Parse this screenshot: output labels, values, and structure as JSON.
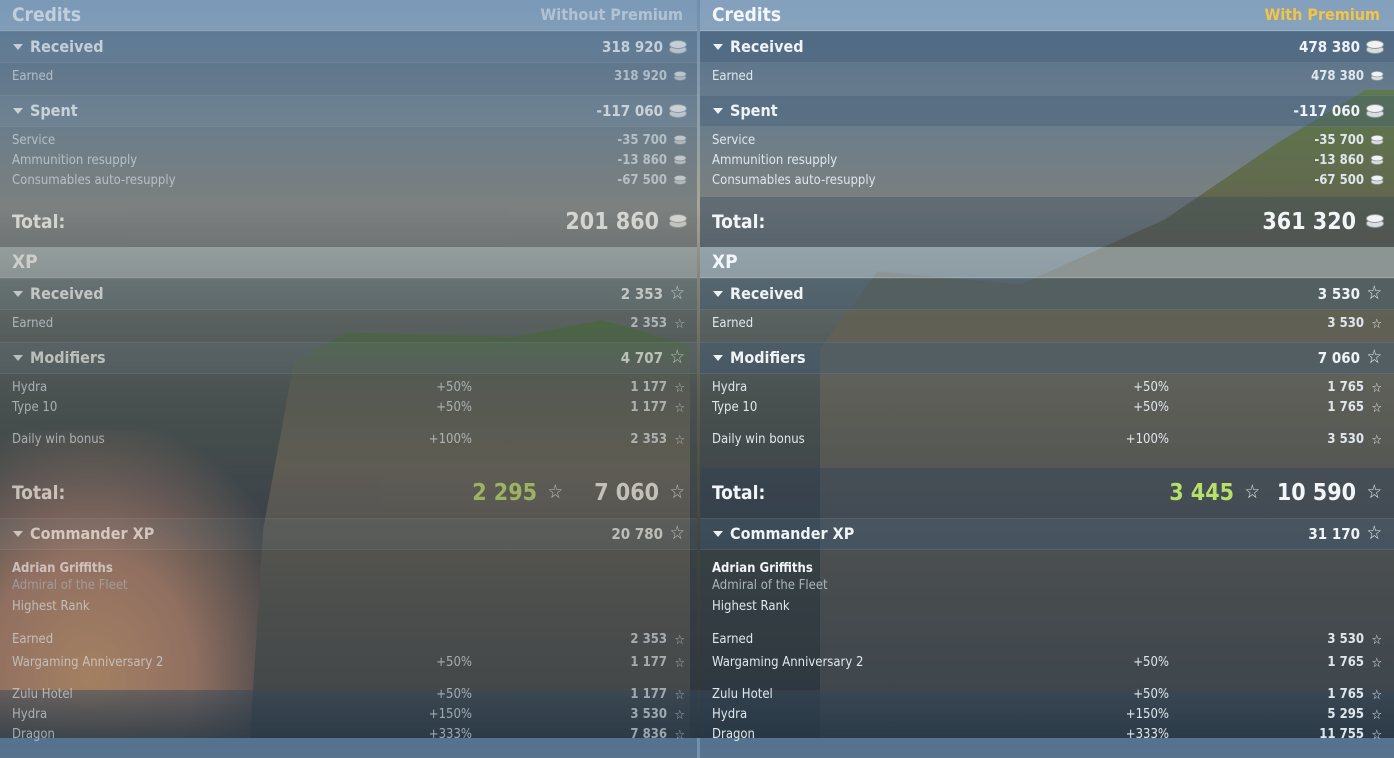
{
  "left": {
    "credits_title": "Credits",
    "variant": "Without Premium",
    "received_label": "Received",
    "received_value": "318 920",
    "earned_label": "Earned",
    "earned_value": "318 920",
    "spent_label": "Spent",
    "spent_value": "-117 060",
    "spent_items": [
      {
        "label": "Service",
        "value": "-35 700"
      },
      {
        "label": "Ammunition resupply",
        "value": "-13 860"
      },
      {
        "label": "Consumables auto-resupply",
        "value": "-67 500"
      }
    ],
    "total_label": "Total:",
    "credits_total": "201 860",
    "xp_title": "XP",
    "xp_received_label": "Received",
    "xp_received_value": "2 353",
    "xp_earned_label": "Earned",
    "xp_earned_value": "2 353",
    "modifiers_label": "Modifiers",
    "modifiers_value": "4 707",
    "modifiers": [
      {
        "label": "Hydra",
        "pct": "+50%",
        "value": "1 177"
      },
      {
        "label": "Type 10",
        "pct": "+50%",
        "value": "1 177"
      },
      {
        "label": "Daily win bonus",
        "pct": "+100%",
        "value": "2 353"
      }
    ],
    "xp_total_free": "2 295",
    "xp_total": "7 060",
    "commander_label": "Commander XP",
    "commander_value": "20 780",
    "commander_name": "Adrian Griffiths",
    "commander_rank": "Admiral of the Fleet",
    "commander_rank2": "Highest Rank",
    "cmd_earned_label": "Earned",
    "cmd_earned_value": "2 353",
    "cmd_items": [
      {
        "label": "Wargaming Anniversary 2",
        "pct": "+50%",
        "value": "1 177"
      },
      {
        "label": "Zulu Hotel",
        "pct": "+50%",
        "value": "1 177"
      },
      {
        "label": "Hydra",
        "pct": "+150%",
        "value": "3 530"
      },
      {
        "label": "Dragon",
        "pct": "+333%",
        "value": "7 836"
      }
    ]
  },
  "right": {
    "credits_title": "Credits",
    "variant": "With Premium",
    "received_label": "Received",
    "received_value": "478 380",
    "earned_label": "Earned",
    "earned_value": "478 380",
    "spent_label": "Spent",
    "spent_value": "-117 060",
    "spent_items": [
      {
        "label": "Service",
        "value": "-35 700"
      },
      {
        "label": "Ammunition resupply",
        "value": "-13 860"
      },
      {
        "label": "Consumables auto-resupply",
        "value": "-67 500"
      }
    ],
    "total_label": "Total:",
    "credits_total": "361 320",
    "xp_title": "XP",
    "xp_received_label": "Received",
    "xp_received_value": "3 530",
    "xp_earned_label": "Earned",
    "xp_earned_value": "3 530",
    "modifiers_label": "Modifiers",
    "modifiers_value": "7 060",
    "modifiers": [
      {
        "label": "Hydra",
        "pct": "+50%",
        "value": "1 765"
      },
      {
        "label": "Type 10",
        "pct": "+50%",
        "value": "1 765"
      },
      {
        "label": "Daily win bonus",
        "pct": "+100%",
        "value": "3 530"
      }
    ],
    "xp_total_free": "3 445",
    "xp_total": "10 590",
    "commander_label": "Commander XP",
    "commander_value": "31 170",
    "commander_name": "Adrian Griffiths",
    "commander_rank": "Admiral of the Fleet",
    "commander_rank2": "Highest Rank",
    "cmd_earned_label": "Earned",
    "cmd_earned_value": "3 530",
    "cmd_items": [
      {
        "label": "Wargaming Anniversary 2",
        "pct": "+50%",
        "value": "1 765"
      },
      {
        "label": "Zulu Hotel",
        "pct": "+50%",
        "value": "1 765"
      },
      {
        "label": "Hydra",
        "pct": "+150%",
        "value": "5 295"
      },
      {
        "label": "Dragon",
        "pct": "+333%",
        "value": "11 755"
      }
    ]
  },
  "colors": {
    "premium_accent": "#f4c444",
    "free_xp_green": "#b7e06a"
  },
  "icons": {
    "credits": "credits-coin-icon",
    "xp": "xp-star-icon",
    "expand": "collapse-triangle-icon"
  }
}
